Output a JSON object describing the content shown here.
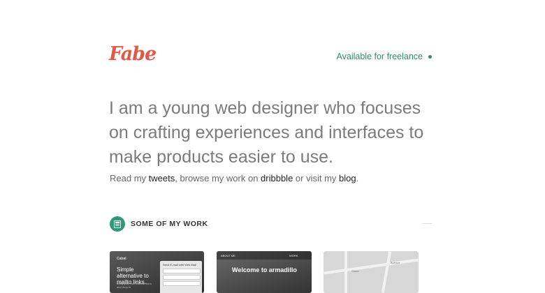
{
  "header": {
    "logo": "Fabe",
    "availability": "Available for freelance"
  },
  "intro": {
    "headline": "I am a young web designer who focuses on crafting experiences and interfaces to make products easier to use.",
    "read_my": "Read my ",
    "tweets": "tweets",
    "browse": ", browse my work on ",
    "dribbble": "dribbble",
    "or_visit": " or visit my ",
    "blog": "blog",
    "period": "."
  },
  "work": {
    "section_title": "SOME OF MY WORK",
    "cards": [
      {
        "brand": "Cabal",
        "headline": "Simple alternative to mailto links.",
        "sub": "Bring your own contact form and drop-in",
        "form_title": "Send E-mail with Web Mail"
      },
      {
        "nav_left": "ABOUT ME",
        "nav_right": "WORK",
        "title": "Welcome to armadillo"
      },
      {
        "streets": [
          "Street",
          "Avenue"
        ]
      }
    ]
  },
  "colors": {
    "accent": "#2e8b6c",
    "logo": "#e05a48"
  }
}
